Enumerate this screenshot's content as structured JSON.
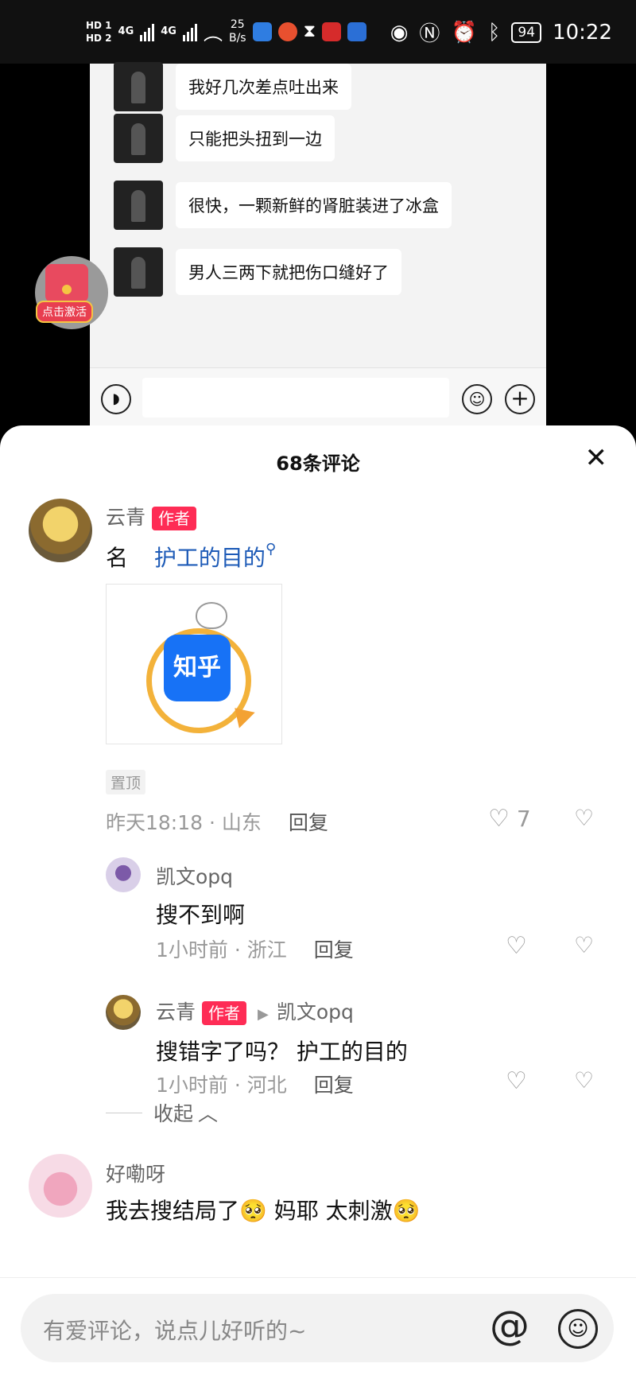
{
  "status_bar": {
    "hd1": "HD 1",
    "hd2": "HD 2",
    "signal1": "4G",
    "signal2": "4G",
    "speed_value": "25",
    "speed_unit": "B/s",
    "battery": "94",
    "time": "10:22"
  },
  "chat": {
    "messages": [
      {
        "text": "我好几次差点吐出来"
      },
      {
        "text": "只能把头扭到一边"
      },
      {
        "text": "很快，一颗新鲜的肾脏装进了冰盒"
      },
      {
        "text": "男人三两下就把伤口缝好了"
      }
    ]
  },
  "float_widget": {
    "label": "点击激活"
  },
  "comments": {
    "title": "68条评论",
    "list": [
      {
        "name": "云青",
        "tag": "作者",
        "text_prefix": "名",
        "link_text": "护工的目的",
        "image_text": "知乎",
        "pin": "置顶",
        "time": "昨天18:18 · 山东",
        "reply": "回复",
        "likes": "7"
      },
      {
        "name": "凯文opq",
        "text": "搜不到啊",
        "time": "1小时前 · 浙江",
        "reply": "回复"
      },
      {
        "name": "云青",
        "tag": "作者",
        "reply_to": "凯文opq",
        "text": "搜错字了吗？  护工的目的",
        "time": "1小时前 · 河北",
        "reply": "回复"
      },
      {
        "name": "好嘞呀",
        "text": "我去搜结局了🥺    妈耶    太刺激🥺"
      }
    ],
    "collapse": "收起"
  },
  "composer": {
    "placeholder": "有爱评论，说点儿好听的~",
    "at": "@"
  },
  "colors": {
    "accent_tag": "#fe2c55",
    "link": "#1e5bb7",
    "zhihu_blue": "#1772f6"
  },
  "icons": [
    "heart-icon",
    "dislike-heart-icon",
    "close-icon",
    "emoji-icon",
    "at-icon",
    "voice-icon",
    "plus-icon"
  ]
}
